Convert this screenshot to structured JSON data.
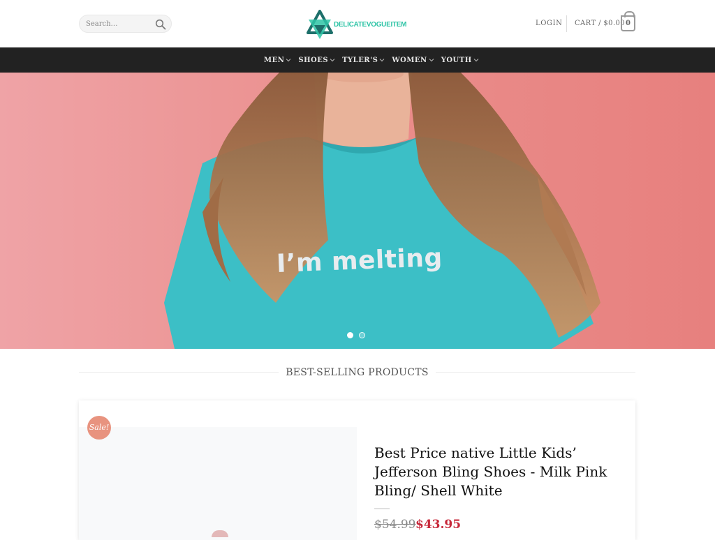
{
  "header": {
    "search_placeholder": "Search…",
    "logo_text": "DELICATEVOGUEITEM",
    "login_label": "LOGIN",
    "cart_label": "CART / $0.00",
    "cart_count": "0"
  },
  "nav": {
    "items": [
      {
        "label": "MEN"
      },
      {
        "label": "SHOES"
      },
      {
        "label": "TYLER'S"
      },
      {
        "label": "WOMEN"
      },
      {
        "label": "YOUTH"
      }
    ]
  },
  "hero": {
    "shirt_text": "I’m melting",
    "slide_count": 2,
    "active_slide": 1
  },
  "section": {
    "title": "BEST-SELLING PRODUCTS"
  },
  "product": {
    "sale_badge": "Sale!",
    "name": "Best Price native Little Kids’ Jefferson Bling Shoes - Milk Pink Bling/ Shell White",
    "price_old": "$54.99",
    "price_new": "$43.95"
  },
  "colors": {
    "nav_bg": "#222222",
    "brand_teal": "#2ec4a6",
    "sale_price": "#c7283a",
    "sale_badge": "#e8937f",
    "hero_bg": "#ec8a88",
    "shirt": "#3cbfc6"
  }
}
